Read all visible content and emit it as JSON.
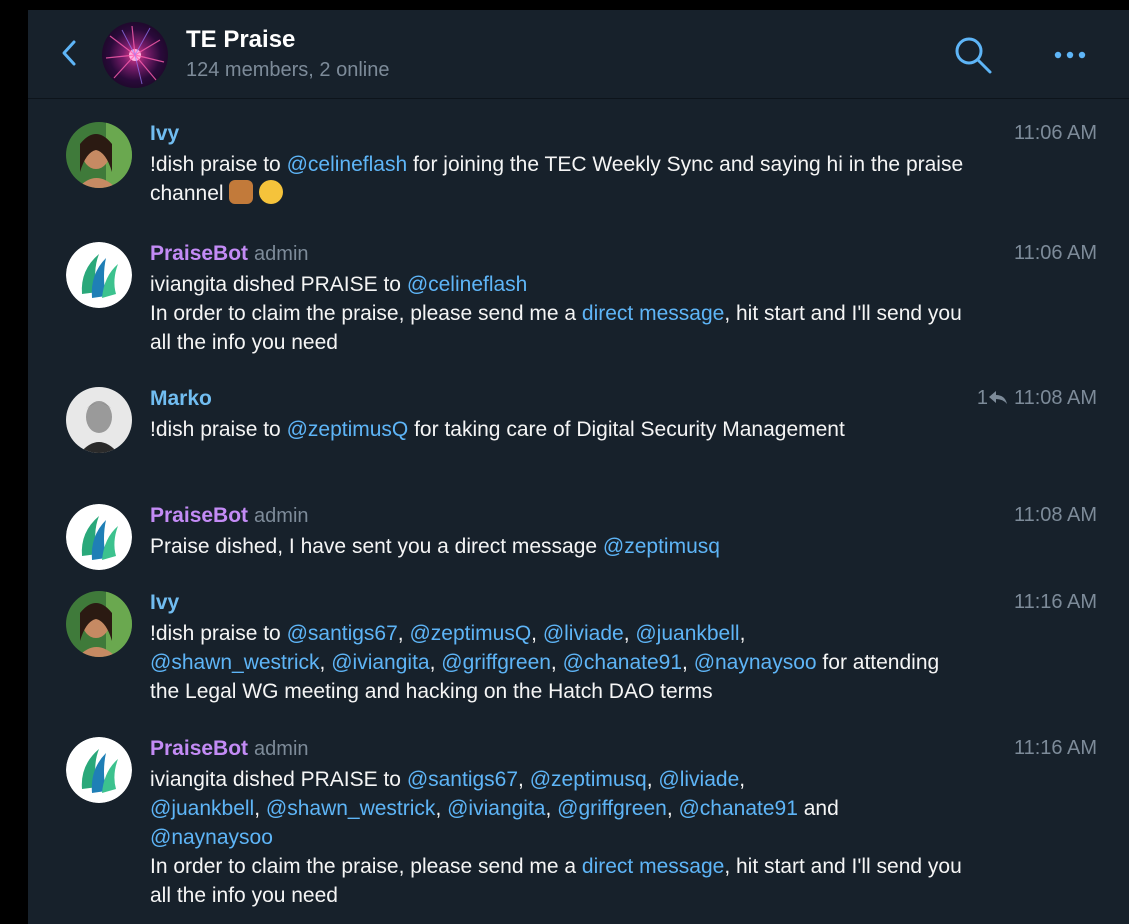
{
  "header": {
    "title": "TE Praise",
    "subtitle": "124 members, 2 online"
  },
  "colors": {
    "background": "#17212b",
    "name_user": "#71bdf1",
    "name_bot": "#c38bf5",
    "link": "#5eb5f7",
    "muted": "#7d8b99"
  },
  "messages": [
    {
      "author": "Ivy",
      "time": "11:06 AM",
      "t1": "!dish praise to ",
      "m1": "@celineflash",
      "t2": " for joining the TEC Weekly Sync and saying hi in the praise channel ",
      "emoji": [
        "raising-hands-icon",
        "grinning-face-icon"
      ]
    },
    {
      "author": "PraiseBot",
      "role": "admin",
      "time": "11:06 AM",
      "t1": "iviangita dished PRAISE to ",
      "m1": "@celineflash",
      "t3": "In order to claim the praise, please send me a ",
      "link": "direct message",
      "t4": ", hit start and I'll send you all the info you need"
    },
    {
      "author": "Marko",
      "time": "11:08 AM",
      "reply_count": "1",
      "t1": "!dish praise to ",
      "m1": "@zeptimusQ",
      "t2": " for taking care of Digital Security Management"
    },
    {
      "author": "PraiseBot",
      "role": "admin",
      "time": "11:08 AM",
      "t1": "Praise dished, I have sent you a direct message ",
      "m1": "@zeptimusq"
    },
    {
      "author": "Ivy",
      "time": "11:16 AM",
      "t1": "!dish praise to ",
      "mentions": [
        "@santigs67",
        "@zeptimusQ",
        "@liviade",
        "@juankbell",
        "@shawn_westrick",
        "@iviangita",
        "@griffgreen",
        "@chanate91",
        "@naynaysoo"
      ],
      "t2": " for attending the Legal WG meeting and hacking on the Hatch DAO terms"
    },
    {
      "author": "PraiseBot",
      "role": "admin",
      "time": "11:16 AM",
      "t1": "iviangita dished PRAISE to ",
      "mentions": [
        "@santigs67",
        "@zeptimusq",
        "@liviade",
        "@juankbell",
        "@shawn_westrick",
        "@iviangita",
        "@griffgreen",
        "@chanate91"
      ],
      "and": " and ",
      "last": "@naynaysoo",
      "t3": "In order to claim the praise, please send me a ",
      "link": "direct message",
      "t4": ", hit start and I'll send you all the info you need"
    }
  ]
}
